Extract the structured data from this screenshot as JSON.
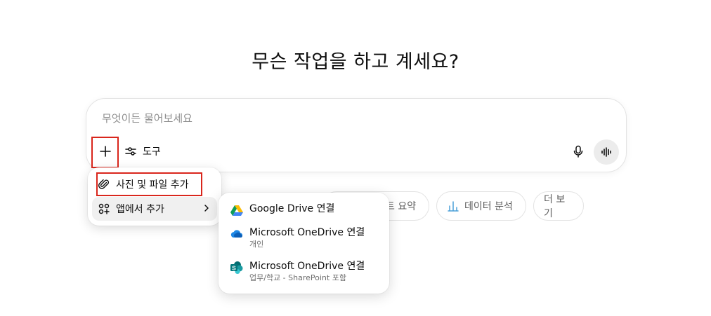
{
  "headline": "무슨 작업을 하고 계세요?",
  "composer": {
    "placeholder": "무엇이든 물어보세요",
    "tools_label": "도구"
  },
  "chips": [
    {
      "label": "트 요약",
      "icon": "document-icon"
    },
    {
      "label": "데이터 분석",
      "icon": "bar-chart-icon"
    },
    {
      "label": "더 보기",
      "icon": "none"
    }
  ],
  "attach_menu": {
    "items": [
      {
        "label": "사진 및 파일 추가",
        "icon": "paperclip-icon"
      },
      {
        "label": "앱에서 추가",
        "icon": "apps-add-icon"
      }
    ]
  },
  "apps_submenu": {
    "items": [
      {
        "title": "Google Drive 연결",
        "caption": "",
        "icon": "google-drive-icon"
      },
      {
        "title": "Microsoft OneDrive 연결",
        "caption": "개인",
        "icon": "onedrive-icon"
      },
      {
        "title": "Microsoft OneDrive 연결",
        "caption": "업무/학교 - SharePoint 포함",
        "icon": "sharepoint-icon"
      }
    ]
  },
  "colors": {
    "highlight": "#d9261c",
    "text": "#0d0d0d",
    "muted": "#8f8f8f",
    "chart_icon": "#4ba0d9"
  }
}
